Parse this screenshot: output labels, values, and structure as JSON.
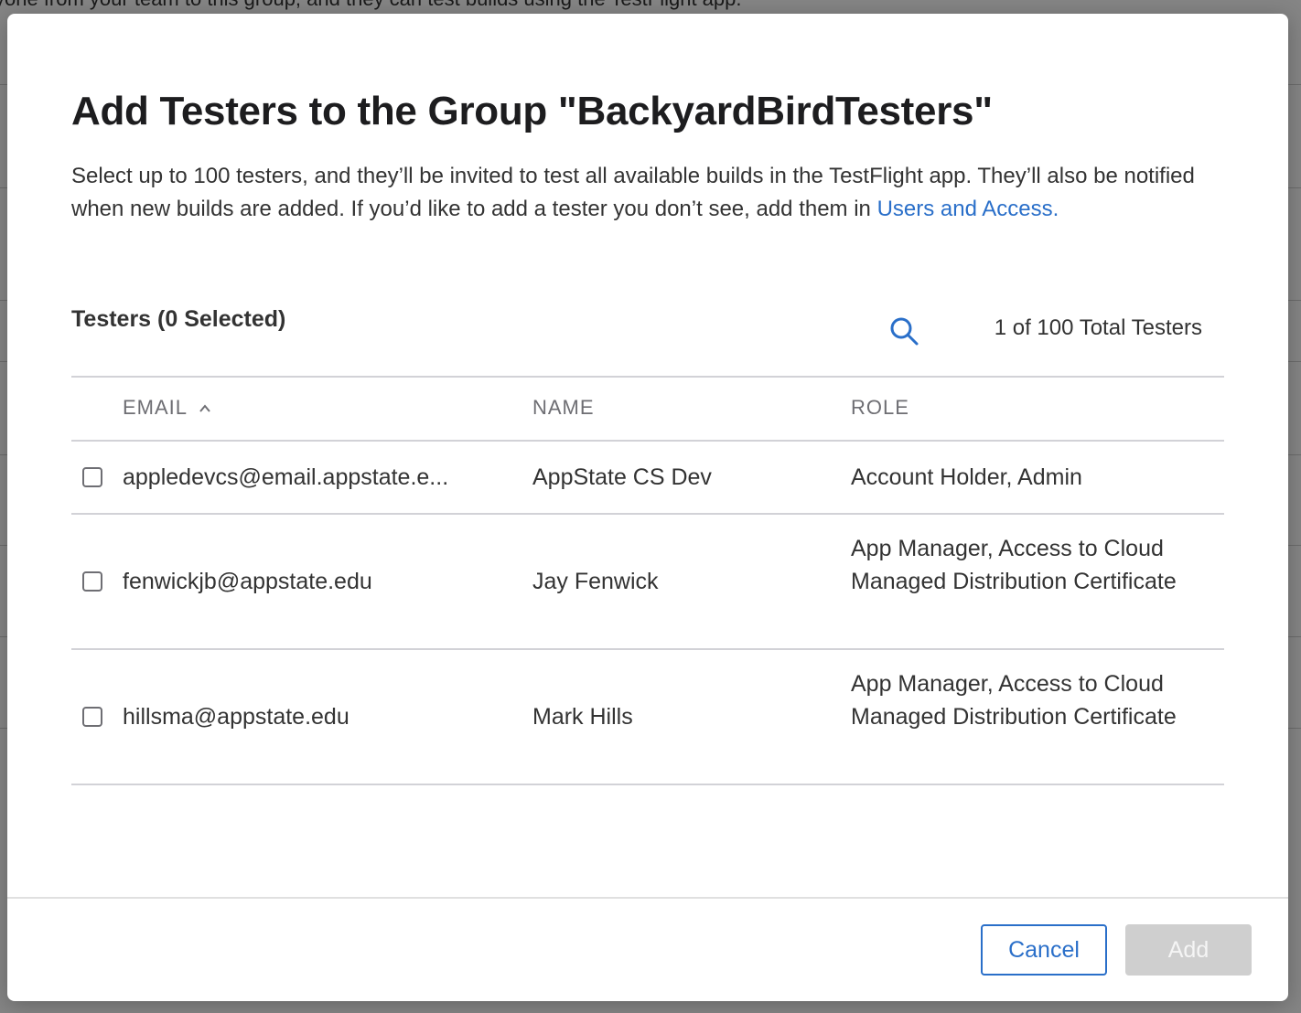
{
  "background": {
    "top_text": "yone from your team to this group, and they can test builds using the TestFlight app."
  },
  "modal": {
    "title": "Add Testers to the Group \"BackyardBirdTesters\"",
    "description": "Select up to 100 testers, and they’ll be invited to test all available builds in the TestFlight app. They’ll also be notified when new builds are added. If you’d like to add a tester you don’t see, add them in ",
    "description_link": "Users and Access.",
    "section_title": "Testers (0 Selected)",
    "total_count": "1 of 100 Total Testers",
    "table": {
      "headers": {
        "email": "EMAIL",
        "name": "NAME",
        "role": "ROLE"
      },
      "rows": [
        {
          "email": "appledevcs@email.appstate.e...",
          "name": "AppState CS Dev",
          "role": "Account Holder, Admin",
          "checked": false
        },
        {
          "email": "fenwickjb@appstate.edu",
          "name": "Jay Fenwick",
          "role": "App Manager, Access to Cloud Managed Distribution Certificate",
          "checked": false
        },
        {
          "email": "hillsma@appstate.edu",
          "name": "Mark Hills",
          "role": "App Manager, Access to Cloud Managed Distribution Certificate",
          "checked": false
        }
      ]
    },
    "buttons": {
      "cancel": "Cancel",
      "add": "Add"
    }
  },
  "icons": {
    "search": "search-icon",
    "sort": "chevron-up-icon"
  },
  "colors": {
    "accent": "#2a6fc9",
    "disabled_button": "#cfcfcf"
  }
}
